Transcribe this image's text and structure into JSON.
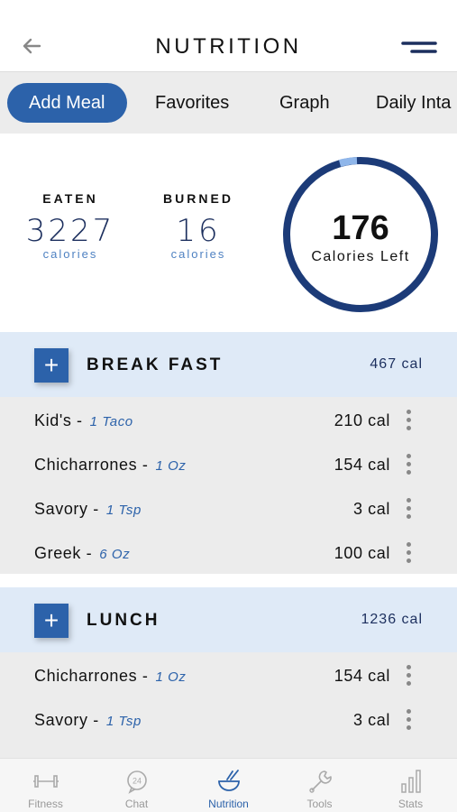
{
  "header": {
    "title": "NUTRITION"
  },
  "tabs": [
    "Add Meal",
    "Favorites",
    "Graph",
    "Daily Inta"
  ],
  "summary": {
    "eaten": {
      "label": "EATEN",
      "value": "3227",
      "unit": "calories"
    },
    "burned": {
      "label": "BURNED",
      "value": "16",
      "unit": "calories"
    },
    "remaining": {
      "value": "176",
      "label": "Calories Left"
    }
  },
  "meals": [
    {
      "title": "BREAK FAST",
      "total": "467 cal",
      "items": [
        {
          "name": "Kid's -",
          "portion": "1 Taco",
          "cal": "210 cal"
        },
        {
          "name": "Chicharrones -",
          "portion": "1 Oz",
          "cal": "154 cal"
        },
        {
          "name": "Savory -",
          "portion": "1 Tsp",
          "cal": "3 cal"
        },
        {
          "name": "Greek -",
          "portion": "6 Oz",
          "cal": "100 cal"
        }
      ]
    },
    {
      "title": "LUNCH",
      "total": "1236 cal",
      "items": [
        {
          "name": "Chicharrones -",
          "portion": "1 Oz",
          "cal": "154 cal"
        },
        {
          "name": "Savory -",
          "portion": "1 Tsp",
          "cal": "3 cal"
        }
      ]
    }
  ],
  "bottom_nav": [
    {
      "label": "Fitness",
      "icon": "dumbbell-icon"
    },
    {
      "label": "Chat",
      "icon": "chat-24-icon"
    },
    {
      "label": "Nutrition",
      "icon": "bowl-icon",
      "active": true
    },
    {
      "label": "Tools",
      "icon": "wrench-icon"
    },
    {
      "label": "Stats",
      "icon": "bar-chart-icon"
    }
  ],
  "colors": {
    "accent": "#2c62aa",
    "dark_navy": "#1c2f5e",
    "section_bg": "#dfeaf7"
  }
}
